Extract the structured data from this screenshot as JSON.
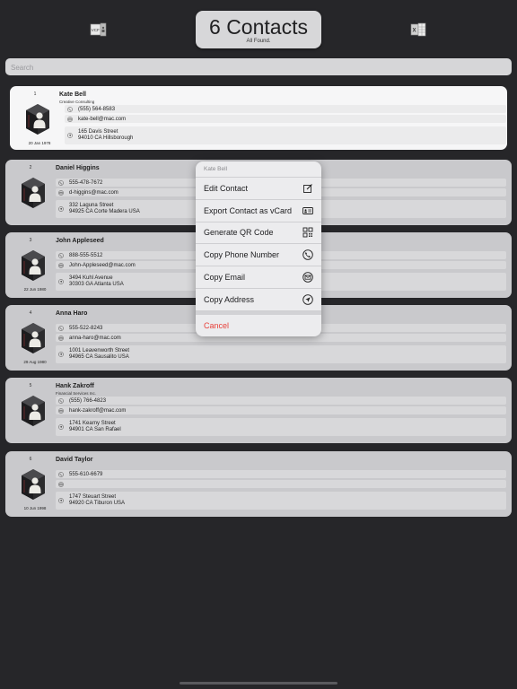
{
  "header": {
    "title": "6 Contacts",
    "subtitle": "All Found.",
    "vcf_icon": "vcf-export-icon",
    "xls_icon": "excel-export-icon"
  },
  "search": {
    "placeholder": "Search"
  },
  "contacts": [
    {
      "index": "1",
      "name": "Kate Bell",
      "company": "Creative Consulting",
      "phone": "(555) 564-8583",
      "email": "kate-bell@mac.com",
      "street": "165 Davis Street",
      "city": "94010 CA Hillsborough",
      "birthday": "20 Jan 1978"
    },
    {
      "index": "2",
      "name": "Daniel Higgins",
      "company": "",
      "phone": "555-478-7672",
      "email": "d-higgins@mac.com",
      "street": "332 Laguna Street",
      "city": "94925 CA Corte Madera USA",
      "birthday": ""
    },
    {
      "index": "3",
      "name": "John Appleseed",
      "company": "",
      "phone": "888-555-5512",
      "email": "John-Appleseed@mac.com",
      "street": "3494 Kuhl Avenue",
      "city": "30303 GA Atlanta USA",
      "birthday": "22 Jun 1980"
    },
    {
      "index": "4",
      "name": "Anna Haro",
      "company": "",
      "phone": "555-522-8243",
      "email": "anna-haro@mac.com",
      "street": "1001  Leavenworth Street",
      "city": "94965 CA Sausalito USA",
      "birthday": "29 Aug 1980"
    },
    {
      "index": "5",
      "name": "Hank Zakroff",
      "company": "Financial Services Inc.",
      "phone": "(555) 766-4823",
      "email": "hank-zakroff@mac.com",
      "street": "1741 Kearny Street",
      "city": "94901 CA San Rafael",
      "birthday": ""
    },
    {
      "index": "6",
      "name": "David Taylor",
      "company": "",
      "phone": "555-610-6679",
      "email": "",
      "street": "1747 Steuart Street",
      "city": "94920 CA Tiburon USA",
      "birthday": "10 Jun 1998"
    }
  ],
  "context_menu": {
    "header": "Kate Bell",
    "items": [
      {
        "label": "Edit Contact",
        "icon": "edit-icon"
      },
      {
        "label": "Export Contact as vCard",
        "icon": "vcard-icon"
      },
      {
        "label": "Generate QR Code",
        "icon": "qr-code-icon"
      },
      {
        "label": "Copy Phone Number",
        "icon": "phone-icon"
      },
      {
        "label": "Copy Email",
        "icon": "email-icon"
      },
      {
        "label": "Copy Address",
        "icon": "location-icon"
      }
    ],
    "cancel": "Cancel"
  },
  "colors": {
    "background": "#262629",
    "card": "#c9c9cc",
    "card_selected": "#f6f6f7",
    "cancel": "#e8403a"
  }
}
